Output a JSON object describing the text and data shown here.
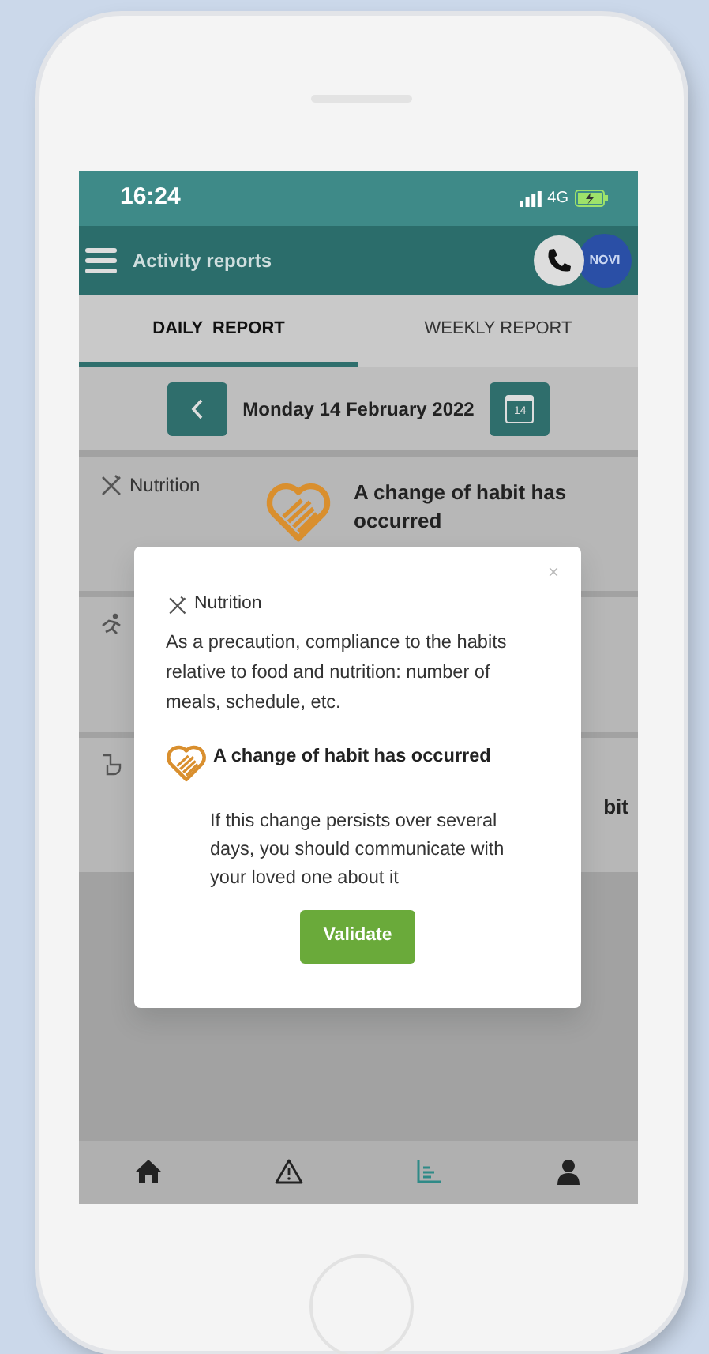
{
  "status_bar": {
    "time": "16:24",
    "network": "4G"
  },
  "app_bar": {
    "title": "Activity reports",
    "logo": "NOVI"
  },
  "tabs": [
    {
      "label": "DAILY  REPORT",
      "selected": true
    },
    {
      "label": "WEEKLY REPORT",
      "selected": false
    }
  ],
  "date_bar": {
    "date": "Monday 14 February 2022",
    "calendar_day": "14"
  },
  "rows": [
    {
      "kind": "nutrition",
      "label": "Nutrition",
      "status": "A change of habit has occurred",
      "status_icon": true
    },
    {
      "kind": "activity"
    },
    {
      "kind": "hygiene",
      "status": "bit",
      "status_icon": false
    }
  ],
  "modal": {
    "close": "×",
    "category": "Nutrition",
    "description": "As a precaution, compliance to the habits relative to food and nutrition: number of meals, schedule, etc.",
    "alert": "A change of habit has occurred",
    "advice": "If this change persists over several days, you should communicate with your loved one about it",
    "button": "Validate"
  },
  "nav": [
    {
      "kind": "home",
      "selected": false
    },
    {
      "kind": "alert",
      "selected": false
    },
    {
      "kind": "chart",
      "selected": true
    },
    {
      "kind": "profile",
      "selected": false
    }
  ]
}
